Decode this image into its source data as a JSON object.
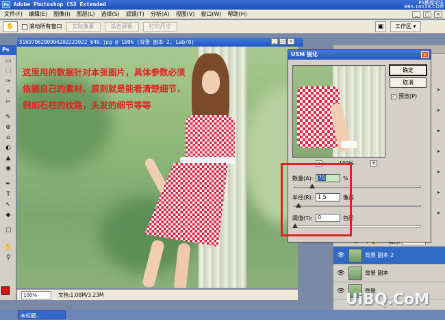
{
  "app": {
    "title": "Adobe Photoshop CS3 Extended",
    "logo": "Ps",
    "watermark_top": "PS教程论坛\nBBS.16XX8.COM",
    "minimize": "_",
    "restore": "□",
    "close": "×"
  },
  "menu": [
    "文件(F)",
    "编辑(E)",
    "图像(I)",
    "图层(L)",
    "选择(S)",
    "滤镜(T)",
    "分析(A)",
    "视图(V)",
    "窗口(W)",
    "帮助(H)"
  ],
  "options": {
    "tool_icon": "hand-icon",
    "tool_glyph": "✋",
    "scroll_all_label": "滚动所有窗口",
    "scroll_all_checked": "",
    "actual_pixels": "实际像素",
    "fit_screen": "适合屏幕",
    "print_size": "打印尺寸",
    "bridge_glyph": "▣",
    "workspace": "工作区 ▾"
  },
  "document": {
    "title": "5169706200904202223022_640.jpg @ 100% (背景 副本 2, Lab/8)",
    "status_zoom": "100%",
    "status_doc": "文档:1.08M/3.23M",
    "annotation": "这里用的数据针对本张图片，具体参数必须依据自己的素材，原则就是能看清楚细节，例如石柱的纹路，头发的细节等等"
  },
  "toolbox": {
    "header": "Ps",
    "tools": [
      "▭",
      "⬚",
      "✑",
      "⌖",
      "✂",
      "✎",
      "⊕",
      "⌂",
      "◐",
      "▲",
      "◉",
      "✒",
      "T",
      "↖",
      "◆",
      "☐",
      "✋",
      "⚲"
    ]
  },
  "dialog": {
    "title": "USM 锐化",
    "close": "×",
    "ok": "确定",
    "cancel": "取消",
    "preview_label": "预览(P)",
    "preview_checked": "✓",
    "zoom_minus": "−",
    "zoom_plus": "+",
    "zoom_level": "100%",
    "amount_label": "数量(A):",
    "amount_value": "70",
    "amount_unit": "%",
    "amount_pct": 0.14,
    "radius_label": "半径(R):",
    "radius_value": "1.5",
    "radius_unit": "像素",
    "radius_pct": 0.03,
    "threshold_label": "阈值(T):",
    "threshold_value": "0",
    "threshold_unit": "色阶",
    "threshold_pct": 0.0
  },
  "layers": {
    "fill_label": "填充:",
    "fill_value": "100%",
    "tool_icons": "⊞ ✎ ✚ 🔒",
    "rows": [
      {
        "name": "背景 副本 2",
        "eye": "👁",
        "selected": true
      },
      {
        "name": "背景 副本",
        "eye": "👁",
        "selected": false
      },
      {
        "name": "背景",
        "eye": "👁",
        "selected": false
      }
    ]
  },
  "taskbar": {
    "item": "未标题..."
  },
  "watermark_bottom": "UiBQ.CoM",
  "colors": {
    "accent": "#2557c0",
    "annotation": "#e02020",
    "foreground": "#e01010"
  }
}
